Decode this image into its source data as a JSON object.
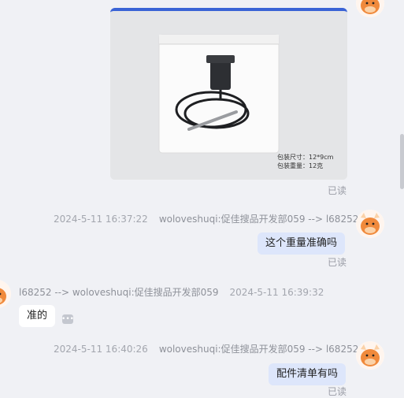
{
  "messages": [
    {
      "kind": "image",
      "read_status": "已读",
      "image_text": {
        "pack_size": "包装尺寸：12*9cm",
        "pack_weight": "包装重量：12克"
      }
    },
    {
      "kind": "text",
      "direction": "out",
      "timestamp": "2024-5-11 16:37:22",
      "route": "woloveshuqi:促佳搜品开发部059 --> l68252",
      "text": "这个重量准确吗",
      "read_status": "已读"
    },
    {
      "kind": "text",
      "direction": "in",
      "route": "l68252 --> woloveshuqi:促佳搜品开发部059",
      "timestamp": "2024-5-11 16:39:32",
      "text": "准的",
      "more_icon": "ellipsis-icon"
    },
    {
      "kind": "text",
      "direction": "out",
      "timestamp": "2024-5-11 16:40:26",
      "route": "woloveshuqi:促佳搜品开发部059 --> l68252",
      "text": "配件清单有吗",
      "read_status": "已读"
    }
  ],
  "colors": {
    "background": "#f0f1f5",
    "outgoing_bubble": "#dde6fb",
    "incoming_bubble": "#ffffff",
    "image_accent_bar": "#3a63d6",
    "avatar_face": "#f08a3c"
  }
}
